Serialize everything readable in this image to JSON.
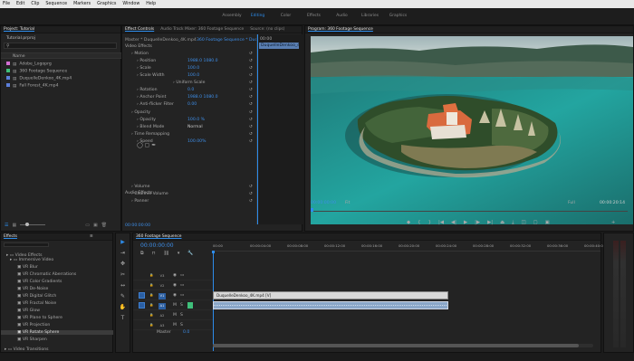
{
  "menu": [
    "File",
    "Edit",
    "Clip",
    "Sequence",
    "Markers",
    "Graphics",
    "Window",
    "Help"
  ],
  "workspaces": [
    "Assembly",
    "Editing",
    "Color",
    "Effects",
    "Audio",
    "Libraries",
    "Graphics"
  ],
  "active_workspace": "Editing",
  "project": {
    "title": "Project: Tutorial",
    "project_file": "Tutorial.prproj",
    "column_name": "Name",
    "items": [
      {
        "name": "Adobe_Logoprg",
        "color": "#d36fd4"
      },
      {
        "name": "360 Footage Sequence",
        "color": "#3fbf7a"
      },
      {
        "name": "DuquelleDenkoo_4K.mp4",
        "color": "#5c7fd9"
      },
      {
        "name": "Fall Forest_4K.mp4",
        "color": "#5c7fd9"
      }
    ]
  },
  "effect_controls": {
    "tabs": [
      "Effect Controls",
      "Audio Track Mixer: 360 Footage Sequence",
      "Source: (no clips)"
    ],
    "master": "Master * DuquelleDenkoo_4K.mp4",
    "sequence_ref": "360 Footage Sequence * Duque",
    "timecode_ruler": "00:00",
    "clip_label": "DuquelleDenkoo_4K.mp4",
    "sections": {
      "video": "Video Effects",
      "audio": "Audio Effects"
    },
    "params": [
      {
        "name": "Motion",
        "value": ""
      },
      {
        "name": "Position",
        "value": "1988.0   1080.0"
      },
      {
        "name": "Scale",
        "value": "100.0"
      },
      {
        "name": "Scale Width",
        "value": "100.0"
      },
      {
        "name": "Uniform Scale",
        "value": ""
      },
      {
        "name": "Rotation",
        "value": "0.0"
      },
      {
        "name": "Anchor Point",
        "value": "1988.0   1080.0"
      },
      {
        "name": "Anti-flicker Filter",
        "value": "0.00"
      },
      {
        "name": "Opacity",
        "value": ""
      },
      {
        "name": "Opacity",
        "value": "100.0 %"
      },
      {
        "name": "Blend Mode",
        "value": "Normal"
      },
      {
        "name": "Time Remapping",
        "value": ""
      },
      {
        "name": "Speed",
        "value": "100.00%"
      },
      {
        "name": "Volume",
        "value": ""
      },
      {
        "name": "Channel Volume",
        "value": ""
      },
      {
        "name": "Panner",
        "value": ""
      }
    ],
    "footer_timecode": "00:00:00:00"
  },
  "program": {
    "title": "Program: 360 Footage Sequence",
    "timecode": "00:00:00:00",
    "fit": "Fit",
    "quality": "Full",
    "duration": "00:00:20:14"
  },
  "effects_panel": {
    "title": "Effects",
    "folders": [
      "Video Effects",
      "Immersive Video",
      "Video Transitions"
    ],
    "items": [
      "VR Blur",
      "VR Chromatic Aberrations",
      "VR Color Gradients",
      "VR De-Noise",
      "VR Digital Glitch",
      "VR Fractal Noise",
      "VR Glow",
      "VR Plane to Sphere",
      "VR Projection",
      "VR Rotate Sphere",
      "VR Sharpen"
    ],
    "selected": "VR Rotate Sphere"
  },
  "timeline": {
    "title": "360 Footage Sequence",
    "timecode": "00:00:00:00",
    "ruler": [
      "00:00",
      "00:00:04:00",
      "00:00:08:00",
      "00:00:12:00",
      "00:00:16:00",
      "00:00:20:00",
      "00:00:24:00",
      "00:00:28:00",
      "00:00:32:00",
      "00:00:36:00",
      "00:00:40:00"
    ],
    "tracks_video": [
      "V3",
      "V2",
      "V1"
    ],
    "tracks_audio": [
      "A1",
      "A2",
      "A3"
    ],
    "master_label": "Master",
    "master_value": "0.0",
    "clip_video": "DuquelleDenkoo_4K.mp4 [V]",
    "clip_audio": ""
  },
  "colors": {
    "accent": "#2d8ceb",
    "clip_video": "#d8d8d8",
    "clip_audio": "#8aa7c9",
    "track_blue": "#2b5fa3"
  }
}
